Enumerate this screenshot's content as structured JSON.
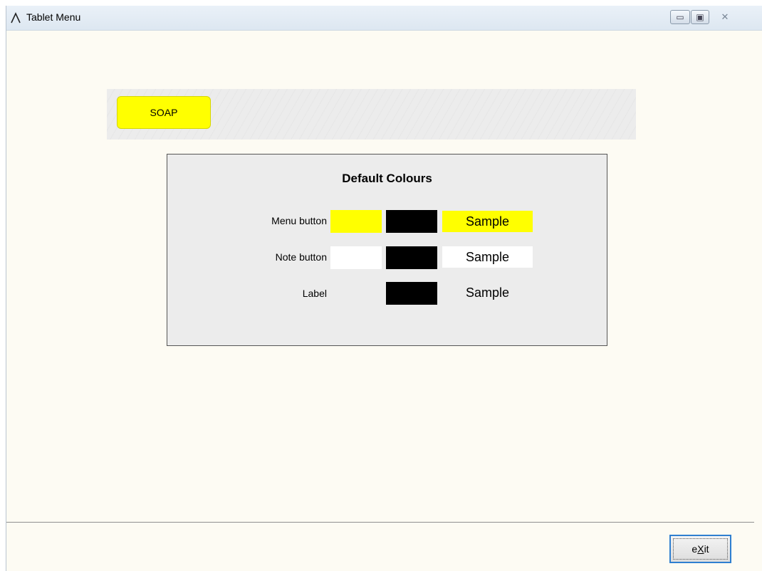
{
  "window": {
    "title": "Tablet Menu",
    "controls": {
      "minimize": "▭",
      "maximize": "▣",
      "close": "✕"
    }
  },
  "menu_strip": {
    "buttons": [
      {
        "label": "SOAP",
        "color": "#ffff00"
      }
    ]
  },
  "default_colours": {
    "title": "Default Colours",
    "rows": [
      {
        "label": "Menu button",
        "background": "#ffff00",
        "foreground": "#000000",
        "sample": "Sample"
      },
      {
        "label": "Note button",
        "background": "#ffffff",
        "foreground": "#000000",
        "sample": "Sample"
      },
      {
        "label": "Label",
        "foreground": "#000000",
        "sample": "Sample"
      }
    ]
  },
  "footer": {
    "exit": {
      "prefix": "e",
      "accel": "X",
      "suffix": "it"
    }
  },
  "icons": {
    "app": "app-logo-icon"
  }
}
